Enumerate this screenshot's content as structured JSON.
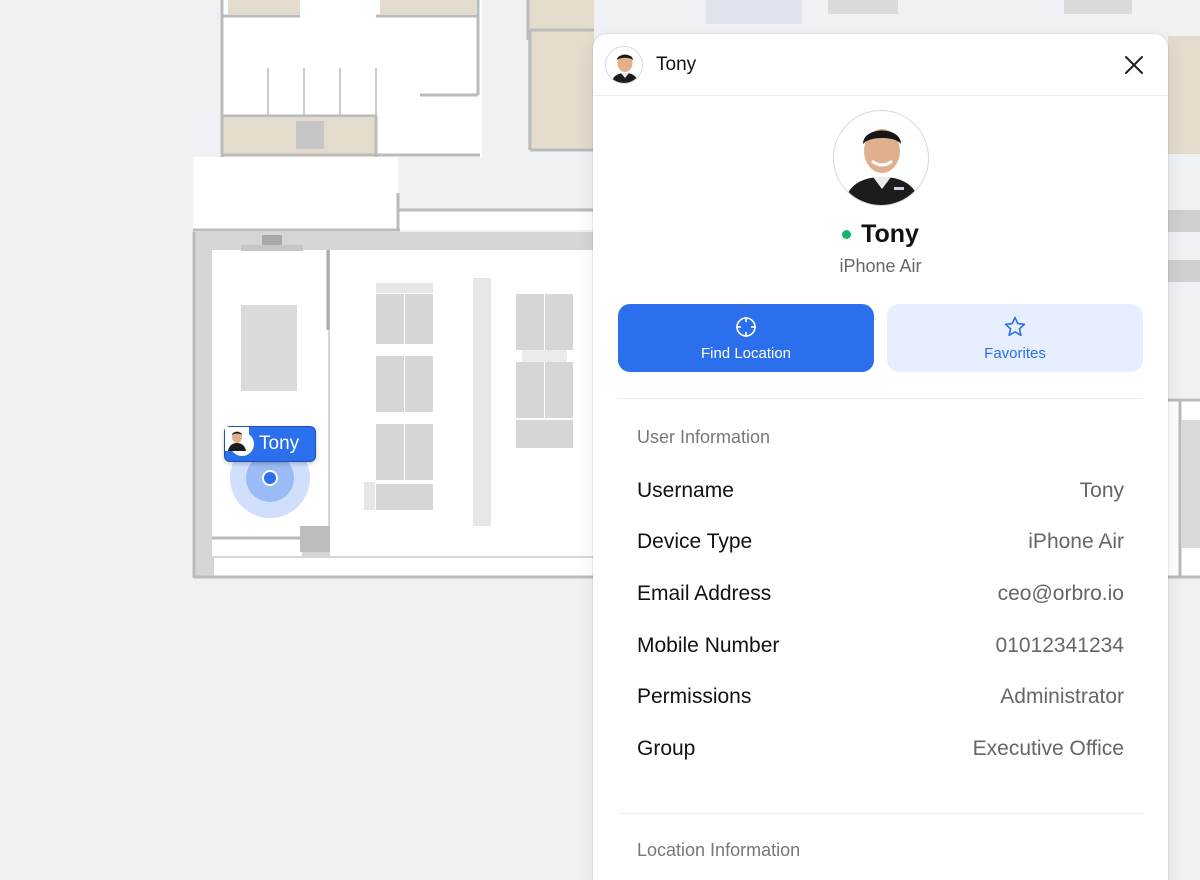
{
  "map": {
    "marker": {
      "label": "Tony"
    }
  },
  "panel": {
    "header_name": "Tony",
    "profile": {
      "name": "Tony",
      "device": "iPhone Air",
      "status_color": "#18b46b"
    },
    "actions": {
      "find_location": "Find Location",
      "favorites": "Favorites"
    },
    "user_info": {
      "title": "User Information",
      "rows": [
        {
          "label": "Username",
          "value": "Tony"
        },
        {
          "label": "Device Type",
          "value": "iPhone Air"
        },
        {
          "label": "Email Address",
          "value": "ceo@orbro.io"
        },
        {
          "label": "Mobile Number",
          "value": "01012341234"
        },
        {
          "label": "Permissions",
          "value": "Administrator"
        },
        {
          "label": "Group",
          "value": "Executive Office"
        }
      ]
    },
    "location_info": {
      "title": "Location Information"
    }
  },
  "colors": {
    "accent": "#2b6fec",
    "accent_light": "#e7eefd",
    "online": "#18b46b"
  },
  "icons": [
    "close-icon",
    "crosshair-icon",
    "star-icon",
    "avatar"
  ]
}
